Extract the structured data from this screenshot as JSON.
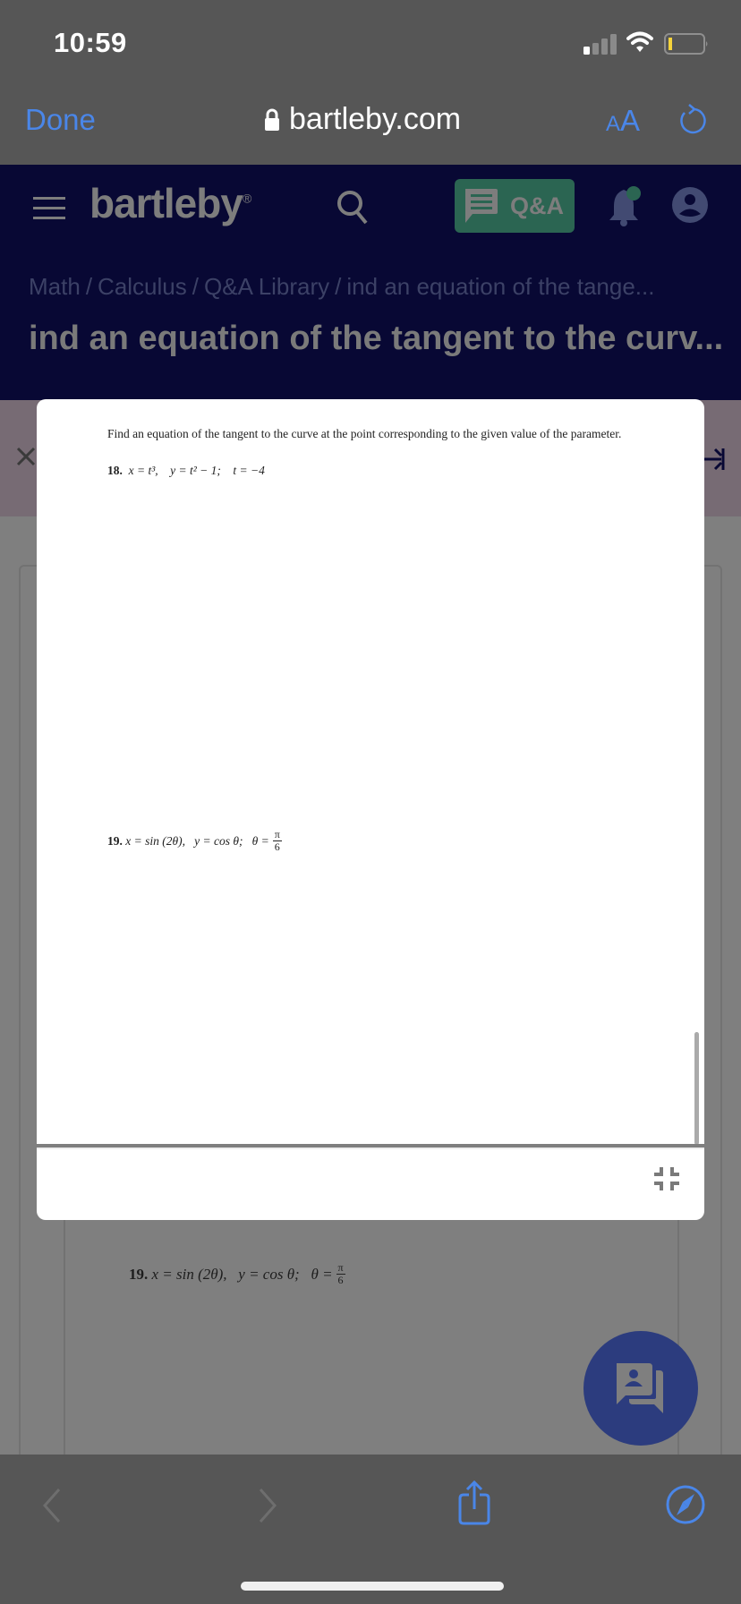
{
  "status_bar": {
    "time": "10:59"
  },
  "browser": {
    "done_label": "Done",
    "url": "bartleby.com",
    "text_size_small": "A",
    "text_size_large": "A",
    "accent": "#4a86e8"
  },
  "site_header": {
    "logo": "bartleby",
    "logo_mark": "®",
    "qa_label": "Q&A",
    "breadcrumb": [
      "Math",
      "Calculus",
      "Q&A Library",
      "ind an equation of the tange..."
    ],
    "breadcrumb_separator": "/",
    "page_title": "ind an equation of the tangent to the curv..."
  },
  "modal": {
    "intro": "Find an equation of the tangent to the curve at the point corresponding to the given value of the parameter.",
    "problems": [
      {
        "number": "18.",
        "x_eq": "x = t³,",
        "y_eq": "y = t² − 1;",
        "param": "t = −4"
      },
      {
        "number": "19.",
        "x_eq": "x = sin (2θ),",
        "y_eq": "y = cos θ;",
        "param_lhs": "θ =",
        "param_num": "π",
        "param_den": "6"
      }
    ]
  },
  "background_page": {
    "problem_19": {
      "number": "19.",
      "text": "x = sin (2θ),   y = cos θ;   θ =",
      "param_num": "π",
      "param_den": "6"
    }
  },
  "colors": {
    "header_bg": "#080834",
    "qa_green": "#2b6552",
    "chat_fab": "#2c3c7e"
  }
}
